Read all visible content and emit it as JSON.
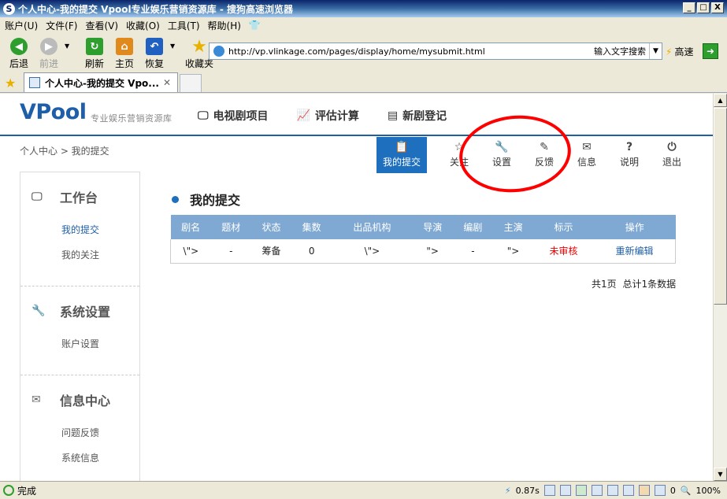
{
  "window": {
    "title": "个人中心-我的提交 Vpool专业娱乐营销资源库 - 搜狗高速浏览器",
    "min": "_",
    "max": "□",
    "close": "X"
  },
  "menu": [
    "账户(U)",
    "文件(F)",
    "查看(V)",
    "收藏(O)",
    "工具(T)",
    "帮助(H)"
  ],
  "toolbar": {
    "back": "后退",
    "forward": "前进",
    "refresh": "刷新",
    "home": "主页",
    "restore": "恢复",
    "favorites": "收藏夹"
  },
  "address": {
    "url": "http://vp.vlinkage.com/pages/display/home/mysubmit.html",
    "search_label": "输入文字搜索",
    "speed": "高速"
  },
  "tab": {
    "title": "个人中心-我的提交 Vpo...",
    "close": "✕"
  },
  "status": {
    "text": "完成",
    "time": "0.87s",
    "count": "0",
    "zoom": "100%"
  },
  "page": {
    "logo": "VPool",
    "slogan": "专业娱乐营销资源库",
    "nav": [
      "电视剧项目",
      "评估计算",
      "新剧登记"
    ],
    "breadcrumb": "个人中心 > 我的提交",
    "user_tabs": [
      {
        "label": "我的提交",
        "icon": "clipboard-icon"
      },
      {
        "label": "关注",
        "icon": "star-icon"
      },
      {
        "label": "设置",
        "icon": "wrench-icon"
      },
      {
        "label": "反馈",
        "icon": "pencil-icon"
      },
      {
        "label": "信息",
        "icon": "mail-icon"
      },
      {
        "label": "说明",
        "icon": "help-icon"
      },
      {
        "label": "退出",
        "icon": "power-icon"
      }
    ],
    "sidebar": [
      {
        "title": "工作台",
        "items": [
          "我的提交",
          "我的关注"
        ]
      },
      {
        "title": "系统设置",
        "items": [
          "账户设置"
        ]
      },
      {
        "title": "信息中心",
        "items": [
          "问题反馈",
          "系统信息"
        ]
      }
    ],
    "heading": "我的提交",
    "table": {
      "headers": [
        "剧名",
        "题材",
        "状态",
        "集数",
        "出品机构",
        "导演",
        "编剧",
        "主演",
        "标示",
        "操作"
      ],
      "rows": [
        [
          "\\\">",
          "-",
          "筹备",
          "0",
          "\\\">",
          "\">",
          "-",
          "\">",
          "未审核",
          "重新编辑"
        ]
      ]
    },
    "pager": "共1页 总计1条数据",
    "accent_color": "#1f6fbf",
    "annotation_color": "#ff0000"
  }
}
